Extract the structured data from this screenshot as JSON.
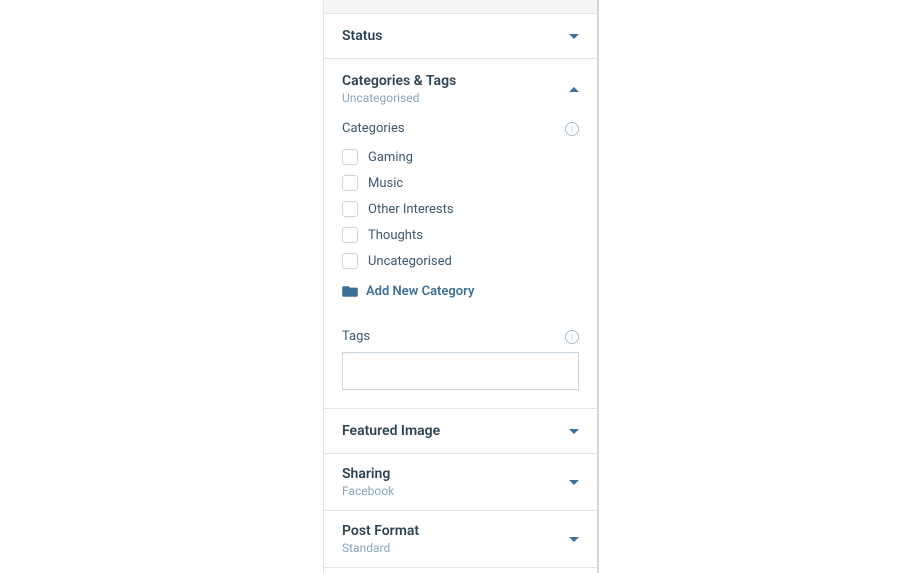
{
  "panels": {
    "status": {
      "title": "Status"
    },
    "categoriesTags": {
      "title": "Categories & Tags",
      "subtitle": "Uncategorised",
      "categoriesLabel": "Categories",
      "tagsLabel": "Tags",
      "addNewCategory": "Add New Category",
      "items": [
        {
          "label": "Gaming"
        },
        {
          "label": "Music"
        },
        {
          "label": "Other Interests"
        },
        {
          "label": "Thoughts"
        },
        {
          "label": "Uncategorised"
        }
      ]
    },
    "featuredImage": {
      "title": "Featured Image"
    },
    "sharing": {
      "title": "Sharing",
      "subtitle": "Facebook"
    },
    "postFormat": {
      "title": "Post Format",
      "subtitle": "Standard"
    }
  }
}
